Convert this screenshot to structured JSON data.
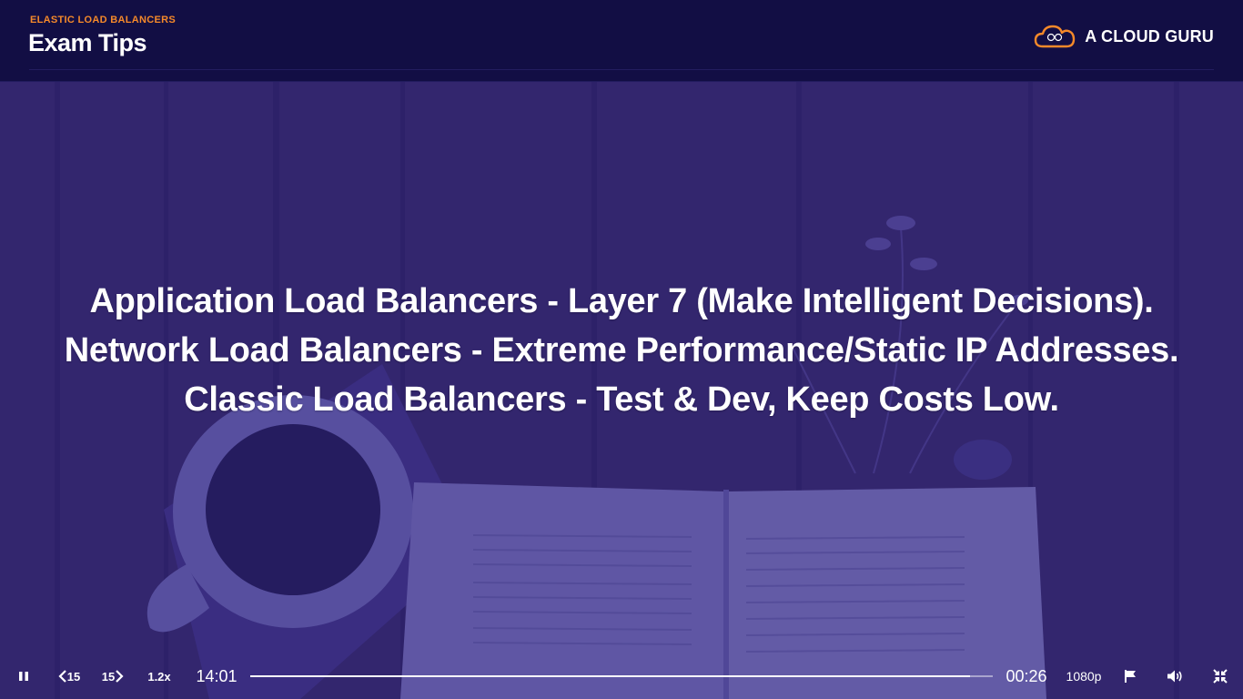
{
  "header": {
    "section_label": "ELASTIC LOAD BALANCERS",
    "title": "Exam Tips",
    "brand_name": "A CLOUD GURU",
    "brand_icon": "cloud-logo-icon"
  },
  "slide": {
    "lines": [
      "Application Load Balancers - Layer 7 (Make Intelligent Decisions).",
      "Network Load Balancers - Extreme Performance/Static IP Addresses.",
      "Classic Load Balancers - Test & Dev, Keep Costs Low."
    ]
  },
  "player": {
    "rewind_label": "15",
    "forward_label": "15",
    "speed": "1.2x",
    "elapsed": "14:01",
    "remaining": "00:26",
    "quality": "1080p",
    "progress": 0.969,
    "icons": {
      "pause": "pause-icon",
      "rewind": "rewind-15-icon",
      "forward": "forward-15-icon",
      "flag": "flag-icon",
      "volume": "volume-icon",
      "exit_fullscreen": "exit-fullscreen-icon"
    }
  },
  "colors": {
    "accent": "#f5892a",
    "header_bg": "#120e44",
    "overlay": "#2d237d"
  }
}
